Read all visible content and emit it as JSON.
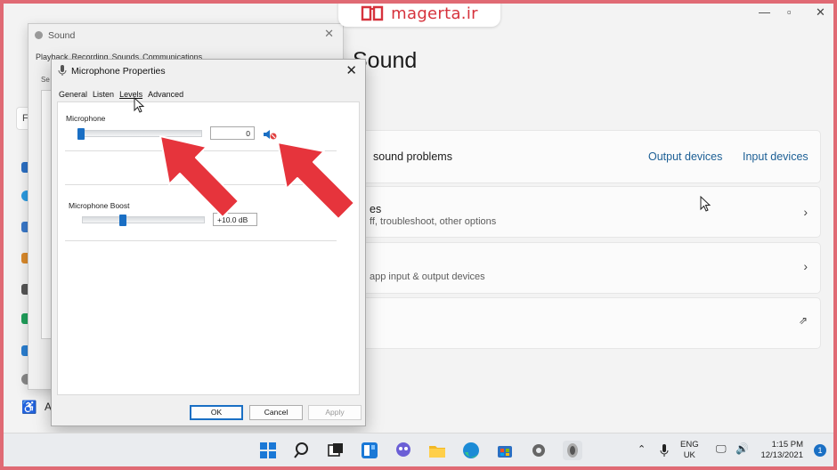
{
  "watermark": {
    "text": "magerta.ir"
  },
  "settings": {
    "title": "Sound",
    "troubleshoot": {
      "text": "sound problems",
      "output_link": "Output devices",
      "input_link": "Input devices"
    },
    "card2": {
      "title": "es",
      "subtitle": "ff, troubleshoot, other options"
    },
    "card3": {
      "subtitle": "app input & output devices"
    },
    "side_letters": {
      "fi": "Fi",
      "a": "A"
    }
  },
  "sound_dialog": {
    "title": "Sound",
    "tabs": [
      "Playback",
      "Recording",
      "Sounds",
      "Communications"
    ],
    "side_text": "Se"
  },
  "mic_dialog": {
    "title": "Microphone Properties",
    "tabs": [
      "General",
      "Listen",
      "Levels",
      "Advanced"
    ],
    "microphone": {
      "label": "Microphone",
      "value": "0",
      "level_fraction": 0.03
    },
    "boost": {
      "label": "Microphone Boost",
      "value": "+10.0 dB",
      "level_fraction": 0.33
    },
    "buttons": {
      "ok": "OK",
      "cancel": "Cancel",
      "apply": "Apply"
    }
  },
  "tray": {
    "lang_top": "ENG",
    "lang_bottom": "UK",
    "time": "1:15 PM",
    "date": "12/13/2021",
    "notification_count": "1"
  },
  "colors": {
    "accent": "#1a6fc4",
    "arrow": "#e6343c",
    "frame": "#e06a74",
    "link": "#1c5f95"
  }
}
